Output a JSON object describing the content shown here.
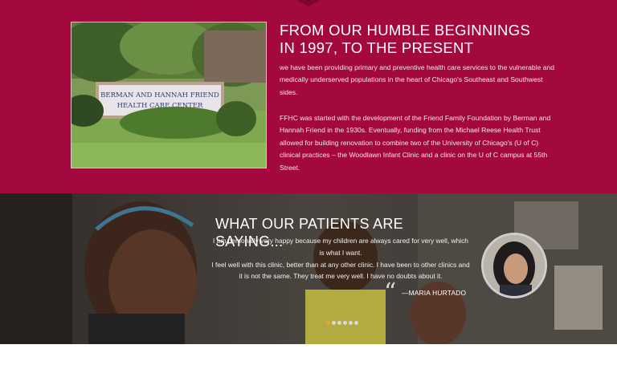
{
  "about": {
    "title_line1": "FROM OUR HUMBLE BEGINNINGS",
    "title_line2": "IN 1997, TO THE PRESENT",
    "paragraph1": "we have been providing primary and preventive health care services to the vulnerable and medically underserved populations in the heart of Chicago's Southeast and Southwest sides.",
    "paragraph2": "FFHC was started with the development of the Friend Family Foundation by Berman and Hannah Friend in the 1930s. Eventually, funding from the Michael Reese Health Trust allowed for building renovation to combine two of the University of Chicago's (U of C) clinical practices – the Woodlawn Infant Clinic and a clinic on the U of C campus at 55th Street.",
    "photo_sign_line1": "BERMAN AND HANNAH FRIEND",
    "photo_sign_line2": "HEALTH CARE CENTER"
  },
  "testimonials": {
    "title": "WHAT OUR PATIENTS ARE SAYING...",
    "quote_line1": "I am personally very happy because my children are always cared for very well, which is what I want.",
    "quote_line2": "I feel well with this clinic, better than at any other clinic. I have been to other clinics and it is not the same. They treat me very well. I have no doubts about it.",
    "quote_mark": "“",
    "author": "—MARIA HURTADO",
    "slides": [
      {
        "label": "slide-1",
        "active": true
      },
      {
        "label": "slide-2",
        "active": false
      },
      {
        "label": "slide-3",
        "active": false
      },
      {
        "label": "slide-4",
        "active": false
      },
      {
        "label": "slide-5",
        "active": false
      },
      {
        "label": "slide-6",
        "active": false
      }
    ]
  },
  "colors": {
    "brand_crimson": "#a3093f",
    "active_dot": "#f0a030"
  }
}
